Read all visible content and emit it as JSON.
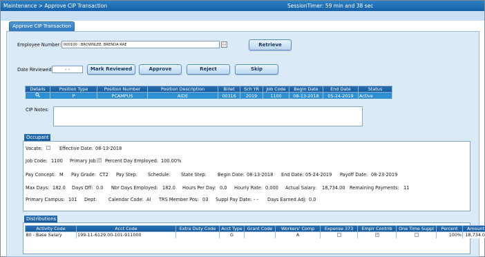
{
  "topbar": {
    "breadcrumb": "Maintenance > Approve CIP Transaction",
    "session_timer": "SessionTimer: 59 min and 38 sec"
  },
  "tab": {
    "label": "Approve CIP Transaction"
  },
  "employee": {
    "label": "Employee Number:",
    "value": "000100 : BROWNLEE, BRENDA RAE",
    "lookup_label": "...",
    "retrieve_label": "Retrieve"
  },
  "actions": {
    "date_reviewed_label": "Date Reviewed:",
    "date_reviewed_value": "- -",
    "mark_reviewed": "Mark Reviewed",
    "approve": "Approve",
    "reject": "Reject",
    "skip": "Skip"
  },
  "position_table": {
    "headers": [
      "Details",
      "Position Type",
      "Position Number",
      "Position Description",
      "Billet",
      "Sch YR",
      "Job Code",
      "Begin Date",
      "End Date",
      "Status"
    ],
    "row": {
      "details_icon": "magnifier-icon",
      "position_type": "P",
      "position_number": "PCAMPUS",
      "position_description": "AIDE",
      "billet": "00316",
      "sch_yr": "2019",
      "job_code": "1100",
      "begin_date": "08-13-2018",
      "end_date": "05-24-2019",
      "status": "Active"
    }
  },
  "cip_notes": {
    "label": "CIP Notes:",
    "value": ""
  },
  "occupant": {
    "title": "Occupant",
    "vacate_label": "Vacate:",
    "vacate_checked": false,
    "effective_date_label": "Effective Date:",
    "effective_date": "08-13-2018",
    "job_code_label": "Job Code:",
    "job_code": "1100",
    "primary_job_label": "Primary Job:",
    "primary_job_checked": true,
    "percent_day_label": "Percent Day Employed:",
    "percent_day": "100.00%",
    "pay_concept_label": "Pay Concept:",
    "pay_concept": "M",
    "pay_grade_label": "Pay Grade:",
    "pay_grade": "CT2",
    "pay_step_label": "Pay Step:",
    "schedule_label": "Schedule:",
    "state_step_label": "State Step:",
    "begin_date_label": "Begin Date:",
    "begin_date": "08-13-2018",
    "end_date_label": "End Date:",
    "end_date": "05-24-2019",
    "payoff_date_label": "Payoff Date:",
    "payoff_date": "08-23-2019",
    "max_days_label": "Max Days:",
    "max_days": "182.0",
    "days_off_label": "Days Off:",
    "days_off": "0.0",
    "nbr_days_label": "Nbr Days Employed:",
    "nbr_days": "182.0",
    "hours_per_day_label": "Hours Per Day:",
    "hours_per_day": "0.0",
    "hourly_rate_label": "Hourly Rate:",
    "hourly_rate": "0.000",
    "actual_salary_label": "Actual Salary:",
    "actual_salary": "18,734.00",
    "remaining_payments_label": "Remaining Payments:",
    "remaining_payments": "11",
    "primary_campus_label": "Primary Campus:",
    "primary_campus": "101",
    "dept_label": "Dept:",
    "calendar_code_label": "Calendar Code:",
    "calendar_code": "AI",
    "trs_member_pos_label": "TRS Member Pos:",
    "trs_member_pos": "03",
    "suppl_pay_date_label": "Suppl Pay Date:",
    "suppl_pay_date": "- -",
    "days_earned_adj_label": "Days Earned Adj:",
    "days_earned_adj": "0.0"
  },
  "distributions": {
    "title": "Distributions",
    "headers": [
      "Activity Code",
      "Acct Code",
      "Extra Duty Code",
      "Acct Type",
      "Grant Code",
      "Workers' Comp",
      "Expense 373",
      "Emplr Contrib",
      "One Time Suppl",
      "Percent",
      "Amount"
    ],
    "row": {
      "activity_code": "80 - Base Salary",
      "acct_code": "199-11-6129.00-101-911000",
      "extra_duty_code": "",
      "acct_type": "G",
      "grant_code": "",
      "workers_comp": "A",
      "expense_373": false,
      "emplr_contrib": true,
      "one_time_suppl": false,
      "percent": "100%",
      "amount": "18,734.00"
    }
  },
  "colors": {
    "topbar": "#1e6db3",
    "panel_bg": "#dbeaf7",
    "header_bg": "#1d629f",
    "selected_row": "#2e8fd2"
  }
}
